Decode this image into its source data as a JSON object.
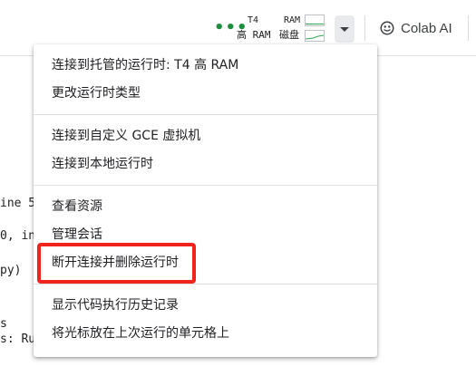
{
  "toolbar": {
    "status_dots": "•••",
    "runtime_gpu": "T4",
    "runtime_ram": "高 RAM",
    "resource_ram": "RAM",
    "resource_disk": "磁盘",
    "colab_ai_label": "Colab AI"
  },
  "background_fragments": [
    "ine 5",
    "0, in",
    "py)",
    "s",
    "s: Ru"
  ],
  "menu": {
    "groups": [
      {
        "items": [
          {
            "label": "连接到托管的运行时: T4 高 RAM"
          },
          {
            "label": "更改运行时类型"
          }
        ]
      },
      {
        "items": [
          {
            "label": "连接到自定义 GCE 虚拟机"
          },
          {
            "label": "连接到本地运行时"
          }
        ]
      },
      {
        "items": [
          {
            "label": "查看资源"
          },
          {
            "label": "管理会话"
          },
          {
            "label": "断开连接并删除运行时"
          }
        ]
      },
      {
        "items": [
          {
            "label": "显示代码执行历史记录"
          },
          {
            "label": "将光标放在上次运行的单元格上"
          }
        ]
      }
    ]
  },
  "colors": {
    "highlight": "#f0241c",
    "status_green": "#1e8e3e"
  }
}
